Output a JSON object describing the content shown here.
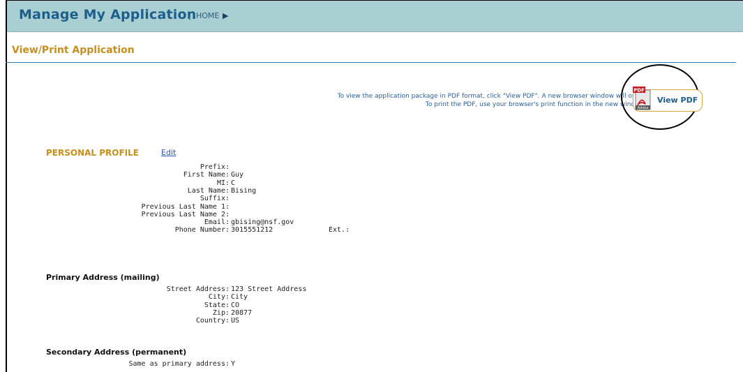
{
  "header": {
    "title": "Manage My Application",
    "separator": "|",
    "home_label": "HOME",
    "home_arrow": "▶"
  },
  "page": {
    "section_title": "View/Print Application"
  },
  "pdf": {
    "note_line1": "To view the application package in PDF format, click \"View PDF\". A new browser window will open",
    "note_line2": "To print the PDF, use your browser's print function in the new window",
    "button_label": "View PDF",
    "icon_badge": "PDF",
    "icon_brand": "Adobe"
  },
  "profile": {
    "heading": "PERSONAL PROFILE",
    "edit_label": "Edit",
    "fields": [
      {
        "label": "Prefix:",
        "value": ""
      },
      {
        "label": "First Name:",
        "value": "Guy"
      },
      {
        "label": "MI:",
        "value": "C"
      },
      {
        "label": "Last Name:",
        "value": "Bising"
      },
      {
        "label": "Suffix:",
        "value": ""
      },
      {
        "label": "Previous Last Name 1:",
        "value": ""
      },
      {
        "label": "Previous Last Name 2:",
        "value": ""
      },
      {
        "label": "Email:",
        "value": "gbising@nsf.gov"
      },
      {
        "label": "Phone Number:",
        "value": "3015551212",
        "ext_label": "Ext.:"
      }
    ]
  },
  "primary_address": {
    "heading": "Primary Address (mailing)",
    "fields": [
      {
        "label": "Street Address:",
        "value": "123 Street Address"
      },
      {
        "label": "City:",
        "value": "City"
      },
      {
        "label": "State:",
        "value": "CO"
      },
      {
        "label": "Zip:",
        "value": "20877"
      },
      {
        "label": "Country:",
        "value": "US"
      }
    ]
  },
  "secondary_address": {
    "heading": "Secondary Address (permanent)",
    "fields": [
      {
        "label": "Same as primary address:",
        "value": "Y"
      }
    ]
  },
  "colors": {
    "header_bg": "#a9cfd3",
    "title": "#1c5f8c",
    "accent": "#c78f1a",
    "rule": "#2f7ab5"
  }
}
